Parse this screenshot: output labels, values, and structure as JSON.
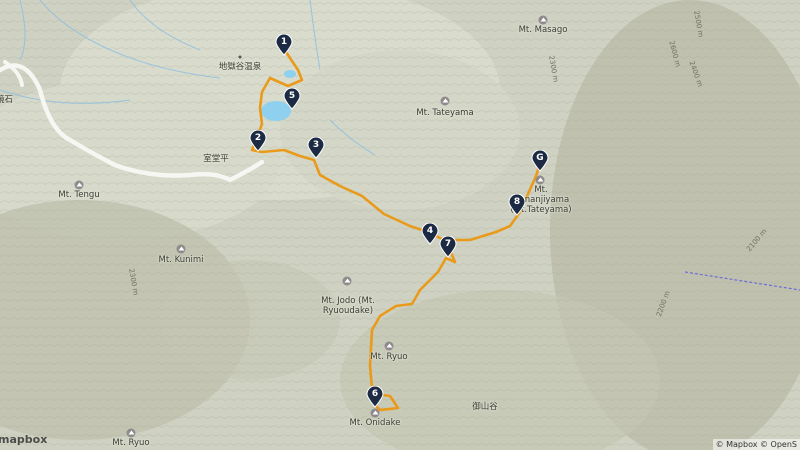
{
  "map": {
    "peaks": [
      {
        "name": "Mt. Masago"
      },
      {
        "name": "Mt. Tateyama"
      },
      {
        "name": "Mt. Oonanjiyama (Mt.Tateyama)"
      },
      {
        "name": "Mt. Tengu"
      },
      {
        "name": "Mt. Kunimi"
      },
      {
        "name": "Mt. Jodo (Mt. Ryuoudake)"
      },
      {
        "name": "Mt. Ryuo"
      },
      {
        "name": "Mt. Onidake"
      },
      {
        "name": "Mt. Ryuo"
      }
    ],
    "place_labels": [
      {
        "name": "地獄谷温泉"
      },
      {
        "name": "室堂平"
      },
      {
        "name": "御山谷"
      },
      {
        "name": "鏡石"
      }
    ],
    "contour_labels": [
      "2500 m",
      "2600 m",
      "2400 m",
      "2300 m",
      "2100 m",
      "2200 m",
      "2300 m"
    ],
    "waypoints": [
      "1",
      "2",
      "3",
      "4",
      "5",
      "6",
      "7",
      "8",
      "G"
    ],
    "attribution": "© Mapbox © OpenS",
    "logo": "mapbox",
    "colors": {
      "route": "#e99a1a",
      "water": "#8fd0ef",
      "pin": "#1d2a44",
      "terrain": "#cfd2c2",
      "boundary": "#6a6fd8"
    }
  }
}
